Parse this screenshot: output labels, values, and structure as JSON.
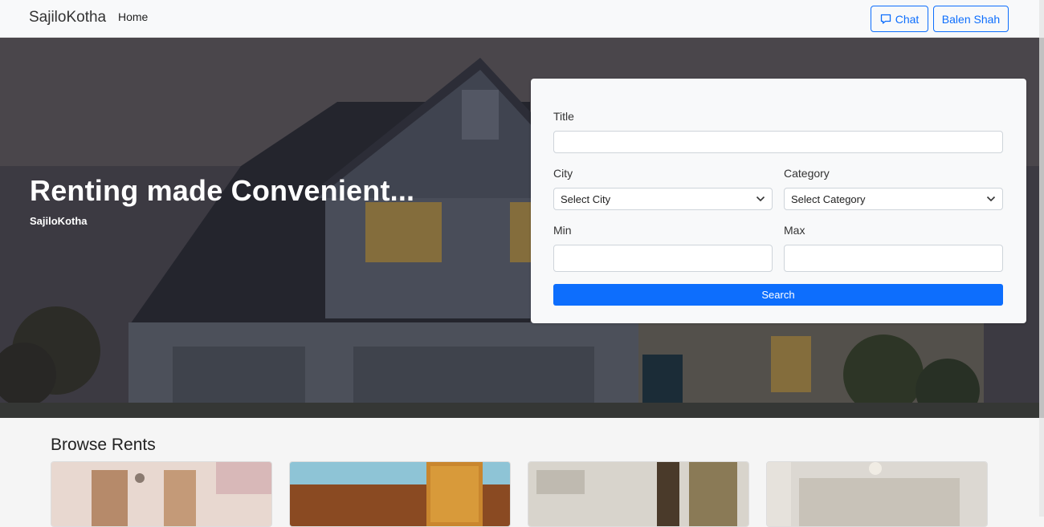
{
  "navbar": {
    "brand": "SajiloKotha",
    "home": "Home",
    "chat_label": "Chat",
    "user_label": "Balen Shah"
  },
  "hero": {
    "title": "Renting made Convenient...",
    "subtitle": "SajiloKotha"
  },
  "search": {
    "title_label": "Title",
    "title_value": "",
    "city_label": "City",
    "city_selected": "Select City",
    "category_label": "Category",
    "category_selected": "Select Category",
    "min_label": "Min",
    "min_value": "",
    "max_label": "Max",
    "max_value": "",
    "button_label": "Search"
  },
  "browse": {
    "title": "Browse Rents",
    "cards": [
      {
        "name": "rent-card-1"
      },
      {
        "name": "rent-card-2"
      },
      {
        "name": "rent-card-3"
      },
      {
        "name": "rent-card-4"
      }
    ]
  },
  "colors": {
    "primary": "#0d6efd",
    "navbar_bg": "#f8f9fa"
  },
  "icons": {
    "chat": "chat-icon",
    "chevron": "chevron-down-icon"
  }
}
